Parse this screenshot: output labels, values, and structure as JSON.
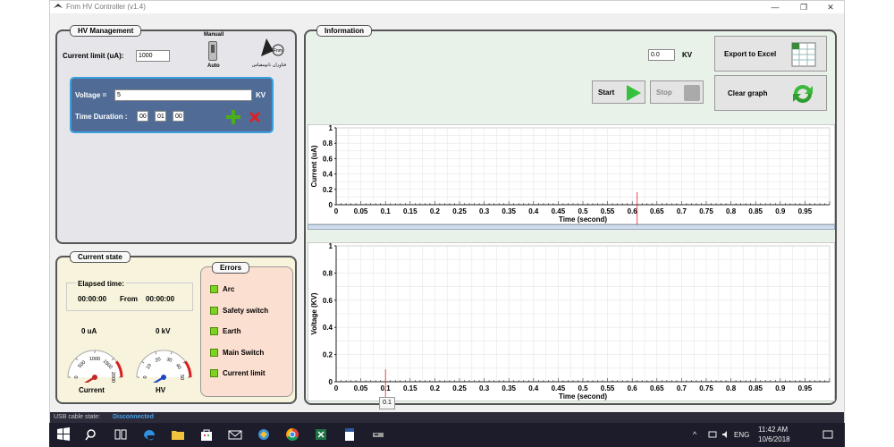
{
  "window": {
    "title": "Fnm HV Controller (v1.4)",
    "minimize": "—",
    "maximize": "❐",
    "close": "✕"
  },
  "hv_management": {
    "legend": "HV Management",
    "current_limit_label": "Current limit (uA):",
    "current_limit_value": "1000",
    "switch_top": "Manuall",
    "switch_bottom": "Auto",
    "logo_text": "فناوران نانومقیاس",
    "logo_mark": "Fnm",
    "voltage_label": "Voltage =",
    "voltage_value": "5",
    "voltage_unit": "KV",
    "duration_label": "Time Duration :",
    "duration_h": "00",
    "duration_m": "01",
    "duration_s": "00"
  },
  "current_state": {
    "legend": "Current state",
    "elapsed_label": "Elapsed time:",
    "elapsed_value": "00:00:00",
    "from_label": "From",
    "from_value": "00:00:00",
    "current_reading": "0 uA",
    "hv_reading": "0 kV",
    "current_caption": "Current",
    "hv_caption": "HV",
    "current_gauge_ticks": [
      "0",
      "500",
      "1000",
      "1500",
      "2000"
    ],
    "hv_gauge_ticks": [
      "0",
      "10",
      "20",
      "30",
      "40",
      "50"
    ],
    "current_level": 0,
    "hv_level": 0
  },
  "errors": {
    "legend": "Errors",
    "items": [
      "Arc",
      "Safety switch",
      "Earth",
      "Main Switch",
      "Current limit"
    ]
  },
  "information": {
    "legend": "Information",
    "kv_value": "0.0",
    "kv_unit": "KV",
    "start_label": "Start",
    "stop_label": "Stop",
    "export_label": "Export to Excel",
    "clear_label": "Clear graph"
  },
  "status_bar": {
    "label": "USB cable state:",
    "value": "Disconnected"
  },
  "cursor_tooltip": "0.1",
  "chart_data": [
    {
      "type": "line",
      "ylabel": "Current (uA)",
      "xlabel": "Time (second)",
      "xlim": [
        0,
        1
      ],
      "ylim": [
        0,
        1
      ],
      "x_ticks": [
        "0",
        "0.05",
        "0.1",
        "0.15",
        "0.2",
        "0.25",
        "0.3",
        "0.35",
        "0.4",
        "0.45",
        "0.5",
        "0.55",
        "0.6",
        "0.65",
        "0.7",
        "0.75",
        "0.8",
        "0.85",
        "0.9",
        "0.95"
      ],
      "y_ticks": [
        "0",
        "0.2",
        "0.4",
        "0.6",
        "0.8",
        "1"
      ],
      "cursor_x": 0.61,
      "series": []
    },
    {
      "type": "line",
      "ylabel": "Voltage (KV)",
      "xlabel": "Time (second)",
      "xlim": [
        0,
        1
      ],
      "ylim": [
        0,
        1
      ],
      "x_ticks": [
        "0",
        "0.05",
        "0.1",
        "0.15",
        "0.2",
        "0.25",
        "0.3",
        "0.35",
        "0.4",
        "0.45",
        "0.5",
        "0.55",
        "0.6",
        "0.65",
        "0.7",
        "0.75",
        "0.8",
        "0.85",
        "0.9",
        "0.95"
      ],
      "y_ticks": [
        "0",
        "0.2",
        "0.4",
        "0.6",
        "0.8",
        "1"
      ],
      "cursor_x": 0.1,
      "series": []
    }
  ],
  "taskbar": {
    "icons": [
      "windows-start-icon",
      "search-icon",
      "task-view-icon",
      "edge-icon",
      "file-explorer-icon",
      "store-icon",
      "mail-icon",
      "app-icon",
      "chrome-icon",
      "excel-icon",
      "word-icon",
      "device-icon"
    ],
    "lang": "ENG",
    "time": "11:42 AM",
    "date": "10/6/2018",
    "tray_up": "^"
  }
}
